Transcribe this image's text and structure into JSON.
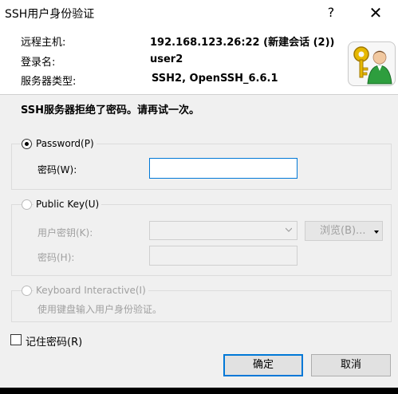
{
  "window": {
    "title": "SSH用户身份验证",
    "help_glyph": "?",
    "close_glyph": "✕"
  },
  "info": [
    {
      "label": "远程主机:",
      "value": "192.168.123.26:22 (新建会话 (2))"
    },
    {
      "label": "登录名:",
      "value": "user2"
    },
    {
      "label": "服务器类型:",
      "value": "SSH2, OpenSSH_6.6.1"
    }
  ],
  "message": "SSH服务器拒绝了密码。请再试一次。",
  "password_method": {
    "label": "Password(P)",
    "selected": true,
    "field_label": "密码(W):",
    "value": ""
  },
  "publickey_method": {
    "label": "Public Key(U)",
    "selected": false,
    "key_label": "用户密钥(K):",
    "key_value": "",
    "browse_label": "浏览(B)...",
    "pass_label": "密码(H):",
    "pass_value": ""
  },
  "keyboard_method": {
    "label": "Keyboard Interactive(I)",
    "selected": false,
    "description": "使用键盘输入用户身份验证。"
  },
  "remember": {
    "label": "记住密码(R)",
    "checked": false
  },
  "buttons": {
    "ok": "确定",
    "cancel": "取消"
  },
  "colors": {
    "accent": "#0078d7",
    "dialog_bg": "#f0f0f0"
  }
}
